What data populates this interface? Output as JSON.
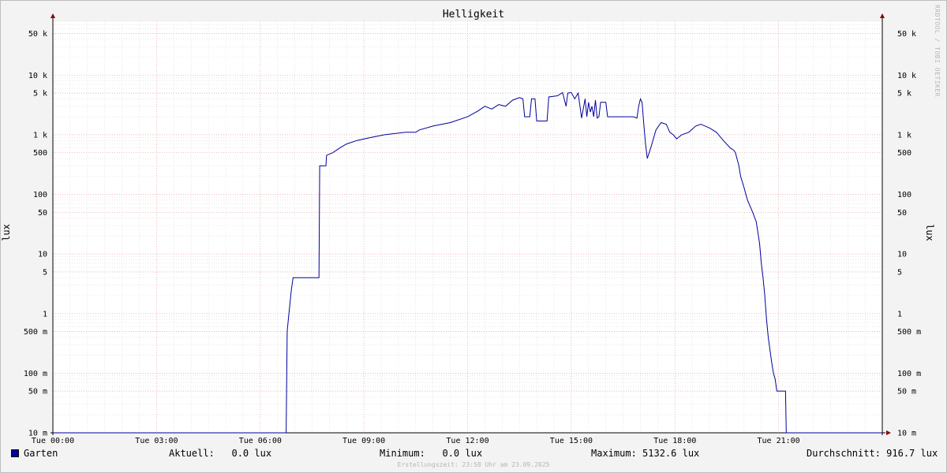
{
  "header": {
    "title": "Helligkeit",
    "watermark": "RRDTOOL / TOBI OETIKER"
  },
  "chart_data": {
    "type": "line",
    "title": "Helligkeit",
    "xlabel": "",
    "ylabel": "lux",
    "y_scale": "log",
    "ylim": [
      0.01,
      80000
    ],
    "xlim": [
      "00:00",
      "24:00"
    ],
    "grid": true,
    "x_ticks": [
      "Tue 00:00",
      "Tue 03:00",
      "Tue 06:00",
      "Tue 09:00",
      "Tue 12:00",
      "Tue 15:00",
      "Tue 18:00",
      "Tue 21:00"
    ],
    "y_ticks": [
      {
        "value": 0.01,
        "label": "10 m"
      },
      {
        "value": 0.05,
        "label": "50 m"
      },
      {
        "value": 0.1,
        "label": "100 m"
      },
      {
        "value": 0.5,
        "label": "500 m"
      },
      {
        "value": 1,
        "label": "1"
      },
      {
        "value": 5,
        "label": "5"
      },
      {
        "value": 10,
        "label": "10"
      },
      {
        "value": 50,
        "label": "50"
      },
      {
        "value": 100,
        "label": "100"
      },
      {
        "value": 500,
        "label": "500"
      },
      {
        "value": 1000,
        "label": "1 k"
      },
      {
        "value": 5000,
        "label": "5 k"
      },
      {
        "value": 10000,
        "label": "10 k"
      },
      {
        "value": 50000,
        "label": "50 k"
      }
    ],
    "series": [
      {
        "name": "Garten",
        "color": "#00009c",
        "points": [
          [
            0.0,
            0.01
          ],
          [
            6.75,
            0.01
          ],
          [
            6.78,
            0.5
          ],
          [
            6.83,
            1.0
          ],
          [
            6.9,
            2.5
          ],
          [
            6.95,
            4.0
          ],
          [
            7.7,
            4.0
          ],
          [
            7.72,
            300
          ],
          [
            7.9,
            300
          ],
          [
            7.92,
            450
          ],
          [
            8.1,
            500
          ],
          [
            8.3,
            600
          ],
          [
            8.5,
            700
          ],
          [
            8.8,
            800
          ],
          [
            9.2,
            900
          ],
          [
            9.6,
            1000
          ],
          [
            10.2,
            1100
          ],
          [
            10.5,
            1100
          ],
          [
            10.6,
            1200
          ],
          [
            11.0,
            1400
          ],
          [
            11.5,
            1600
          ],
          [
            12.0,
            2000
          ],
          [
            12.3,
            2500
          ],
          [
            12.5,
            3000
          ],
          [
            12.7,
            2700
          ],
          [
            12.9,
            3200
          ],
          [
            13.1,
            3000
          ],
          [
            13.3,
            3800
          ],
          [
            13.5,
            4200
          ],
          [
            13.6,
            4000
          ],
          [
            13.65,
            2000
          ],
          [
            13.8,
            2000
          ],
          [
            13.85,
            4000
          ],
          [
            13.95,
            4000
          ],
          [
            14.0,
            1700
          ],
          [
            14.3,
            1700
          ],
          [
            14.35,
            4300
          ],
          [
            14.6,
            4500
          ],
          [
            14.75,
            5100
          ],
          [
            14.85,
            3000
          ],
          [
            14.9,
            5000
          ],
          [
            15.0,
            5100
          ],
          [
            15.1,
            4000
          ],
          [
            15.2,
            5000
          ],
          [
            15.3,
            1900
          ],
          [
            15.4,
            4000
          ],
          [
            15.45,
            2000
          ],
          [
            15.5,
            3500
          ],
          [
            15.55,
            2400
          ],
          [
            15.6,
            3000
          ],
          [
            15.65,
            2000
          ],
          [
            15.7,
            3800
          ],
          [
            15.75,
            1900
          ],
          [
            15.8,
            2000
          ],
          [
            15.85,
            3500
          ],
          [
            16.0,
            3500
          ],
          [
            16.05,
            2000
          ],
          [
            16.2,
            2000
          ],
          [
            16.6,
            2000
          ],
          [
            16.8,
            2000
          ],
          [
            16.9,
            1900
          ],
          [
            16.95,
            3000
          ],
          [
            17.0,
            4000
          ],
          [
            17.05,
            3500
          ],
          [
            17.1,
            1500
          ],
          [
            17.15,
            700
          ],
          [
            17.2,
            400
          ],
          [
            17.3,
            600
          ],
          [
            17.45,
            1200
          ],
          [
            17.6,
            1600
          ],
          [
            17.75,
            1500
          ],
          [
            17.85,
            1100
          ],
          [
            17.95,
            1000
          ],
          [
            18.05,
            850
          ],
          [
            18.2,
            1000
          ],
          [
            18.4,
            1100
          ],
          [
            18.6,
            1400
          ],
          [
            18.75,
            1500
          ],
          [
            19.0,
            1300
          ],
          [
            19.2,
            1100
          ],
          [
            19.4,
            800
          ],
          [
            19.6,
            600
          ],
          [
            19.7,
            550
          ],
          [
            19.75,
            500
          ],
          [
            19.85,
            300
          ],
          [
            19.9,
            200
          ],
          [
            20.0,
            130
          ],
          [
            20.1,
            80
          ],
          [
            20.25,
            50
          ],
          [
            20.35,
            35
          ],
          [
            20.45,
            15
          ],
          [
            20.5,
            7
          ],
          [
            20.55,
            4
          ],
          [
            20.6,
            2
          ],
          [
            20.65,
            0.8
          ],
          [
            20.7,
            0.4
          ],
          [
            20.8,
            0.15
          ],
          [
            20.85,
            0.1
          ],
          [
            20.9,
            0.08
          ],
          [
            20.95,
            0.05
          ],
          [
            21.2,
            0.05
          ],
          [
            21.22,
            0.01
          ],
          [
            24.0,
            0.01
          ]
        ]
      }
    ],
    "legend_position": "bottom-left"
  },
  "legend": {
    "series_name": "Garten",
    "current": "Aktuell:   0.0 lux",
    "minimum": "Minimum:   0.0 lux",
    "maximum": "Maximum: 5132.6 lux",
    "average": "Durchschnitt: 916.7 lux"
  },
  "footer": {
    "created": "Erstellungszeit: 23:58 Uhr am 23.09.2025"
  }
}
